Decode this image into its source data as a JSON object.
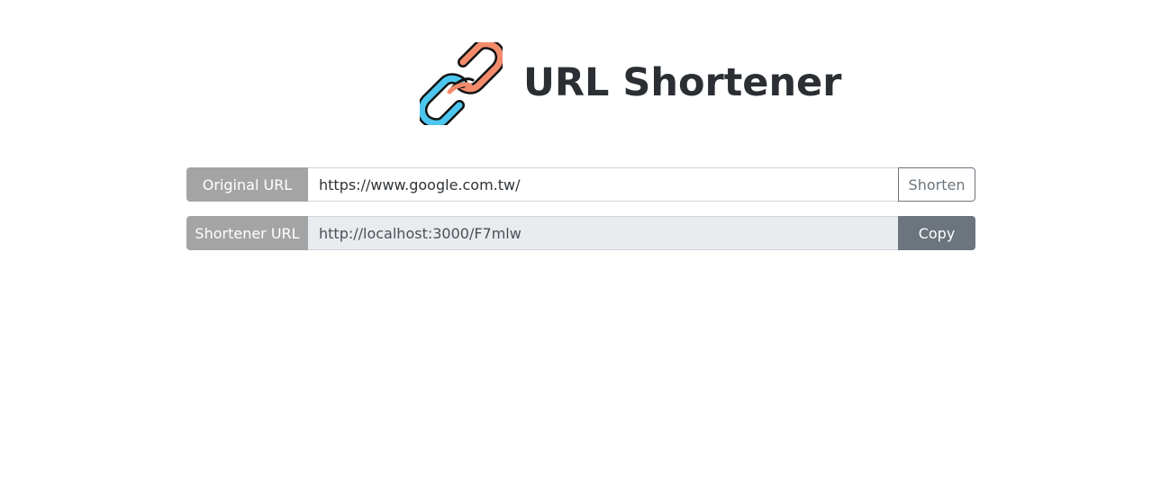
{
  "header": {
    "title": "URL Shortener",
    "logo_icon": "chain-link-icon"
  },
  "form": {
    "original": {
      "label": "Original URL",
      "value": "https://www.google.com.tw/",
      "button_label": "Shorten"
    },
    "shortened": {
      "label": "Shortener URL",
      "value": "http://localhost:3000/F7mlw",
      "button_label": "Copy"
    }
  },
  "colors": {
    "label_background": "#a4a4a4",
    "button_secondary": "#6c757d",
    "readonly_field": "#e9ecef",
    "link_orange": "#f28b6b",
    "link_blue": "#4cc6ef"
  }
}
